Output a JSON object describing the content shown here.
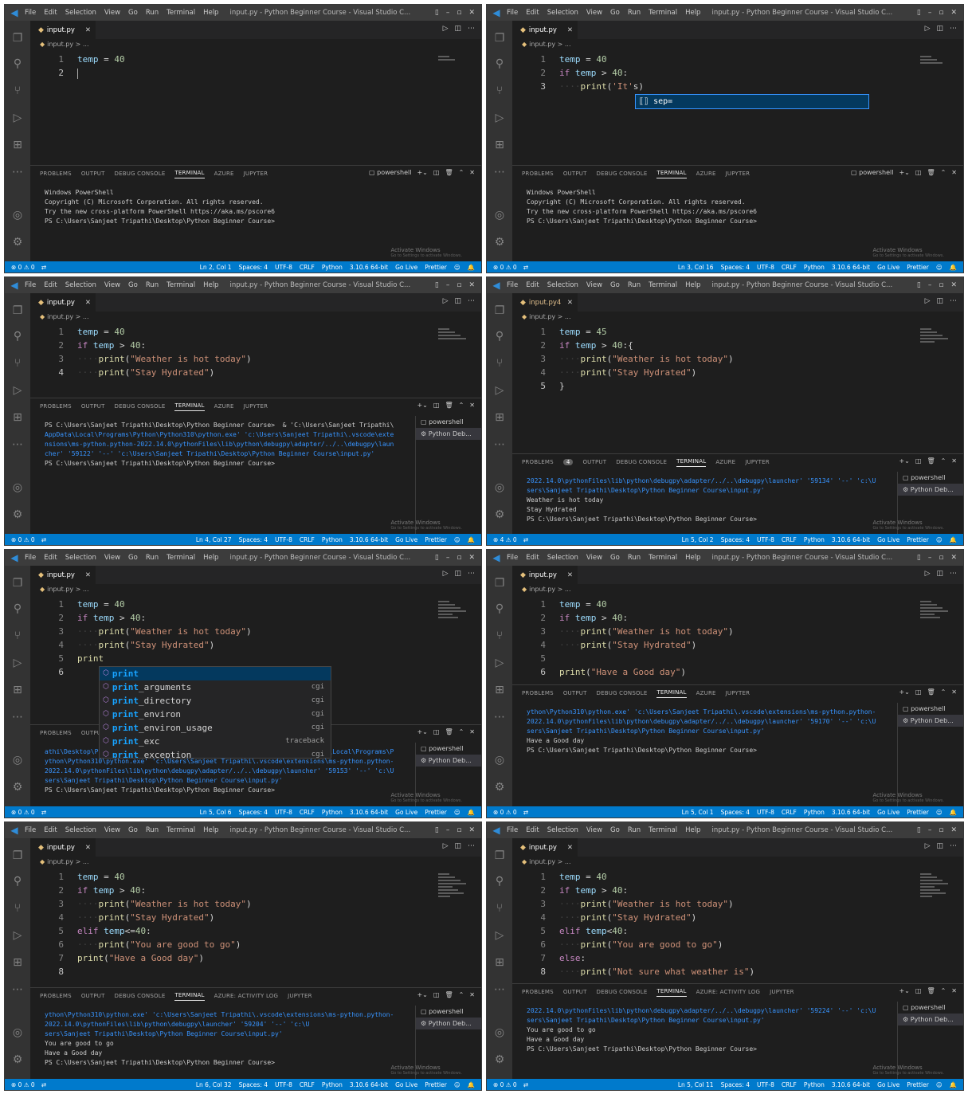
{
  "common": {
    "menu": [
      "File",
      "Edit",
      "Selection",
      "View",
      "Go",
      "Run",
      "Terminal",
      "Help"
    ],
    "window_title": "input.py - Python Beginner Course - Visual Studio C...",
    "tab_label": "input.py",
    "breadcrumb": "input.py > ...",
    "panel_tabs": [
      "PROBLEMS",
      "OUTPUT",
      "DEBUG CONSOLE",
      "TERMINAL",
      "AZURE",
      "JUPYTER"
    ],
    "panel_tabs_alt": [
      "PROBLEMS",
      "OUTPUT",
      "DEBUG CONSOLE",
      "TERMINAL",
      "AZURE: ACTIVITY LOG",
      "JUPYTER"
    ],
    "terminal_list": [
      "powershell",
      "Python Deb..."
    ],
    "activate_title": "Activate Windows",
    "activate_sub": "Go to Settings to activate Windows.",
    "status_left": "⊗ 0 ⚠ 0",
    "status_spaces": "Spaces: 4",
    "status_encoding": "UTF-8",
    "status_eol": "CRLF",
    "status_lang": "Python",
    "status_interpreter": "3.10.6 64-bit",
    "status_golive": "Go Live",
    "status_prettier": "Prettier",
    "colors": {
      "statusbar": "#007acc",
      "titlebar": "#3c3c3c",
      "editor": "#1e1e1e",
      "activitybar": "#333333"
    }
  },
  "panels": [
    {
      "cursor": "Ln 2, Col 1",
      "lines": [
        "temp = 40",
        ""
      ],
      "terminal": [
        "Windows PowerShell",
        "Copyright (C) Microsoft Corporation. All rights reserved.",
        "",
        "Try the new cross-platform PowerShell https://aka.ms/pscore6",
        "",
        "PS C:\\Users\\Sanjeet Tripathi\\Desktop\\Python Beginner Course> "
      ]
    },
    {
      "cursor": "Ln 3, Col 16",
      "lines": [
        "temp = 40",
        "if temp > 40:",
        "    print('It's)"
      ],
      "suggest": "sep=",
      "terminal": [
        "Windows PowerShell",
        "Copyright (C) Microsoft Corporation. All rights reserved.",
        "",
        "Try the new cross-platform PowerShell https://aka.ms/pscore6",
        "",
        "PS C:\\Users\\Sanjeet Tripathi\\Desktop\\Python Beginner Course> "
      ]
    },
    {
      "cursor": "Ln 4, Col 27",
      "lines": [
        "temp = 40",
        "if temp > 40:",
        "    print(\"Weather is hot today\")",
        "    print(\"Stay Hydrated\")"
      ],
      "terminal": [
        "PS C:\\Users\\Sanjeet Tripathi\\Desktop\\Python Beginner Course>  & 'C:\\Users\\Sanjeet Tripathi\\",
        "AppData\\Local\\Programs\\Python\\Python310\\python.exe' 'c:\\Users\\Sanjeet Tripathi\\.vscode\\exte",
        "nsions\\ms-python.python-2022.14.0\\pythonFiles\\lib\\python\\debugpy\\adapter/../..\\debugpy\\laun",
        "cher' '59122' '--' 'c:\\Users\\Sanjeet Tripathi\\Desktop\\Python Beginner Course\\input.py'",
        "PS C:\\Users\\Sanjeet Tripathi\\Desktop\\Python Beginner Course>"
      ]
    },
    {
      "cursor": "Ln 5, Col 2",
      "status_left": "⊗ 4 ⚠ 0",
      "tab_badge": "4",
      "problems_badge": "4",
      "lines": [
        "temp = 45",
        "if temp > 40:{",
        "    print(\"Weather is hot today\")",
        "    print(\"Stay Hydrated\")",
        "}"
      ],
      "terminal": [
        "2022.14.0\\pythonFiles\\lib\\python\\debugpy\\adapter/../..\\debugpy\\launcher' '59134' '--' 'c:\\U",
        "sers\\Sanjeet Tripathi\\Desktop\\Python Beginner Course\\input.py'",
        "Weather is hot today",
        "Stay Hydrated",
        "PS C:\\Users\\Sanjeet Tripathi\\Desktop\\Python Beginner Course> "
      ]
    },
    {
      "cursor": "Ln 5, Col 6",
      "lines": [
        "temp = 40",
        "if temp > 40:",
        "    print(\"Weather is hot today\")",
        "    print(\"Stay Hydrated\")",
        "print",
        ""
      ],
      "suggestions": [
        [
          "print",
          ""
        ],
        [
          "print_arguments",
          "cgi"
        ],
        [
          "print_directory",
          "cgi"
        ],
        [
          "print_environ",
          "cgi"
        ],
        [
          "print_environ_usage",
          "cgi"
        ],
        [
          "print_exc",
          "traceback"
        ],
        [
          "print_exception",
          "cgi"
        ]
      ],
      "terminal": [
        "athi\\Desktop\\Python Beginner Course'; & 'C:\\Users\\Sanjeet Tripathi\\AppData\\Local\\Programs\\P",
        "ython\\Python310\\python.exe' 'c:\\Users\\Sanjeet Tripathi\\.vscode\\extensions\\ms-python.python-",
        "2022.14.0\\pythonFiles\\lib\\python\\debugpy\\adapter/../..\\debugpy\\launcher' '59153' '--' 'c:\\U",
        "sers\\Sanjeet Tripathi\\Desktop\\Python Beginner Course\\input.py'",
        "PS C:\\Users\\Sanjeet Tripathi\\Desktop\\Python Beginner Course> "
      ]
    },
    {
      "cursor": "Ln 5, Col 1",
      "lines": [
        "temp = 40",
        "if temp > 40:",
        "    print(\"Weather is hot today\")",
        "    print(\"Stay Hydrated\")",
        "",
        "print(\"Have a Good day\")"
      ],
      "terminal": [
        "ython\\Python310\\python.exe' 'c:\\Users\\Sanjeet Tripathi\\.vscode\\extensions\\ms-python.python-",
        "2022.14.0\\pythonFiles\\lib\\python\\debugpy\\adapter/../..\\debugpy\\launcher' '59170' '--' 'c:\\U",
        "sers\\Sanjeet Tripathi\\Desktop\\Python Beginner Course\\input.py'",
        "Have a Good day",
        "PS C:\\Users\\Sanjeet Tripathi\\Desktop\\Python Beginner Course> "
      ]
    },
    {
      "cursor": "Ln 6, Col 32",
      "lines": [
        "temp = 40",
        "if temp > 40:",
        "    print(\"Weather is hot today\")",
        "    print(\"Stay Hydrated\")",
        "elif temp<=40:",
        "    print(\"You are good to go\")",
        "print(\"Have a Good day\")",
        ""
      ],
      "terminal": [
        "ython\\Python310\\python.exe' 'c:\\Users\\Sanjeet Tripathi\\.vscode\\extensions\\ms-python.python-",
        "2022.14.0\\pythonFiles\\lib\\python\\debugpy\\launcher' '59204' '--' 'c:\\U",
        "sers\\Sanjeet Tripathi\\Desktop\\Python Beginner Course\\input.py'",
        "You are good to go",
        "Have a Good day",
        "PS C:\\Users\\Sanjeet Tripathi\\Desktop\\Python Beginner Course> "
      ]
    },
    {
      "cursor": "Ln 5, Col 11",
      "lines": [
        "temp = 40",
        "if temp > 40:",
        "    print(\"Weather is hot today\")",
        "    print(\"Stay Hydrated\")",
        "elif temp<40:",
        "    print(\"You are good to go\")",
        "else:",
        "    print(\"Not sure what weather is\")"
      ],
      "terminal": [
        "2022.14.0\\pythonFiles\\lib\\python\\debugpy\\adapter/../..\\debugpy\\launcher' '59224' '--' 'c:\\U",
        "sers\\Sanjeet Tripathi\\Desktop\\Python Beginner Course\\input.py'",
        "You are good to go",
        "Have a Good day",
        "PS C:\\Users\\Sanjeet Tripathi\\Desktop\\Python Beginner Course> "
      ]
    }
  ]
}
